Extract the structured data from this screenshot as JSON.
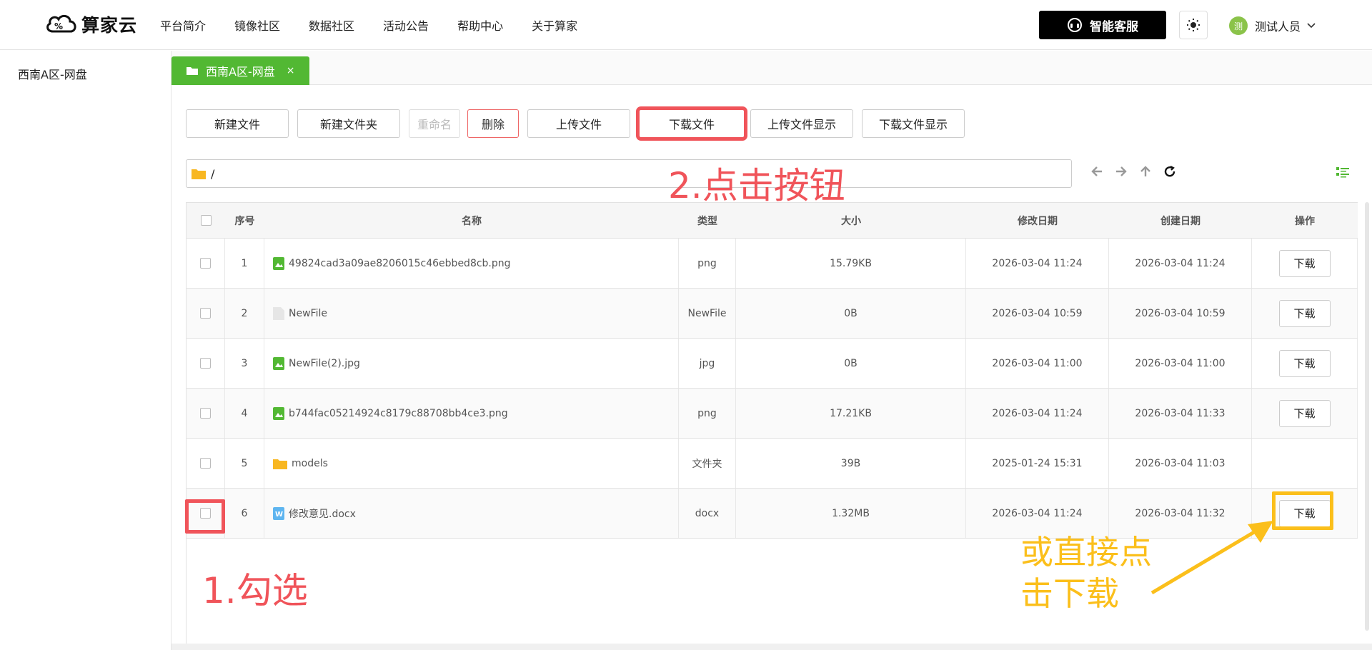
{
  "header": {
    "logo_text": "算家云",
    "nav": [
      "平台简介",
      "镜像社区",
      "数据社区",
      "活动公告",
      "帮助中心",
      "关于算家"
    ],
    "service_label": "智能客服",
    "avatar_text": "测",
    "user_name": "测试人员"
  },
  "sidebar": {
    "items": [
      "西南A区-网盘"
    ]
  },
  "tab": {
    "label": "西南A区-网盘",
    "close": "×"
  },
  "toolbar": {
    "new_file": "新建文件",
    "new_folder": "新建文件夹",
    "rename": "重命名",
    "delete": "删除",
    "upload": "上传文件",
    "download": "下载文件",
    "upload_show": "上传文件显示",
    "download_show": "下载文件显示"
  },
  "path": {
    "value": "/"
  },
  "table": {
    "headers": {
      "index": "序号",
      "name": "名称",
      "type": "类型",
      "size": "大小",
      "modified": "修改日期",
      "created": "创建日期",
      "action": "操作"
    },
    "rows": [
      {
        "index": "1",
        "name": "49824cad3a09ae8206015c46ebbed8cb.png",
        "type": "png",
        "size": "15.79KB",
        "modified": "2026-03-04 11:24",
        "created": "2026-03-04 11:24",
        "action": "下载",
        "icon": "image-icon"
      },
      {
        "index": "2",
        "name": "NewFile",
        "type": "NewFile",
        "size": "0B",
        "modified": "2026-03-04 10:59",
        "created": "2026-03-04 10:59",
        "action": "下载",
        "icon": "file-icon"
      },
      {
        "index": "3",
        "name": "NewFile(2).jpg",
        "type": "jpg",
        "size": "0B",
        "modified": "2026-03-04 11:00",
        "created": "2026-03-04 11:00",
        "action": "下载",
        "icon": "image-icon"
      },
      {
        "index": "4",
        "name": "b744fac05214924c8179c88708bb4ce3.png",
        "type": "png",
        "size": "17.21KB",
        "modified": "2026-03-04 11:24",
        "created": "2026-03-04 11:33",
        "action": "下载",
        "icon": "image-icon"
      },
      {
        "index": "5",
        "name": "models",
        "type": "文件夹",
        "size": "39B",
        "modified": "2025-01-24 15:31",
        "created": "2026-03-04 11:03",
        "action": "",
        "icon": "folder-icon"
      },
      {
        "index": "6",
        "name": "修改意见.docx",
        "type": "docx",
        "size": "1.32MB",
        "modified": "2026-03-04 11:24",
        "created": "2026-03-04 11:32",
        "action": "下载",
        "icon": "word-icon"
      }
    ]
  },
  "annotations": {
    "step1": "1.勾选",
    "step2": "2.点击按钮",
    "alt_line1": "或直接点",
    "alt_line2": "击下载"
  },
  "colors": {
    "brand_green": "#52b833",
    "annotation_red": "#f0545a",
    "annotation_yellow": "#fbbf1b"
  }
}
